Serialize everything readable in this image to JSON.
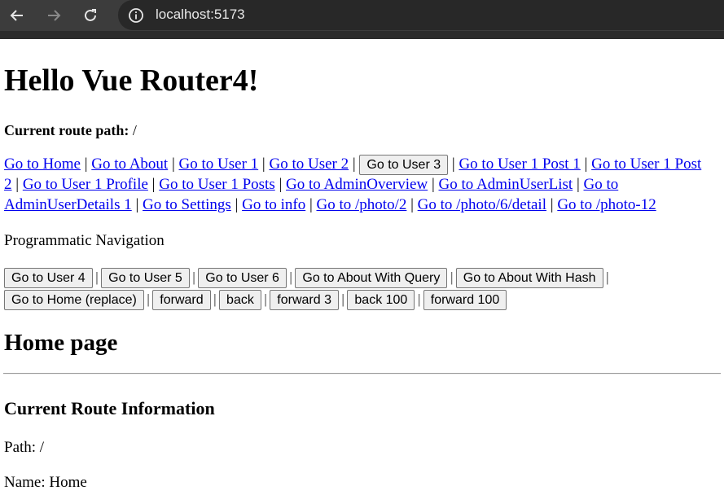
{
  "browser": {
    "url": "localhost:5173"
  },
  "page": {
    "title": "Hello Vue Router4!",
    "route_path_label": "Current route path:",
    "route_path_value": "/",
    "links": [
      "Go to Home",
      "Go to About",
      "Go to User 1",
      "Go to User 2",
      "Go to User 3",
      "Go to User 1 Post 1",
      "Go to User 1 Post 2",
      "Go to User 1 Profile",
      "Go to User 1 Posts",
      "Go to AdminOverview",
      "Go to AdminUserList",
      "Go to AdminUserDetails 1",
      "Go to Settings",
      "Go to info",
      "Go to /photo/2",
      "Go to /photo/6/detail",
      "Go to /photo-12"
    ],
    "programmatic_title": "Programmatic Navigation",
    "programmatic_buttons": [
      "Go to User 4",
      "Go to User 5",
      "Go to User 6",
      "Go to About With Query",
      "Go to About With Hash",
      "Go to Home (replace)",
      "forward",
      "back",
      "forward 3",
      "back 100",
      "forward 100"
    ],
    "separator": "|",
    "home_heading": "Home page",
    "info_heading": "Current Route Information",
    "path_line": "Path: /",
    "name_line": "Name: Home"
  }
}
